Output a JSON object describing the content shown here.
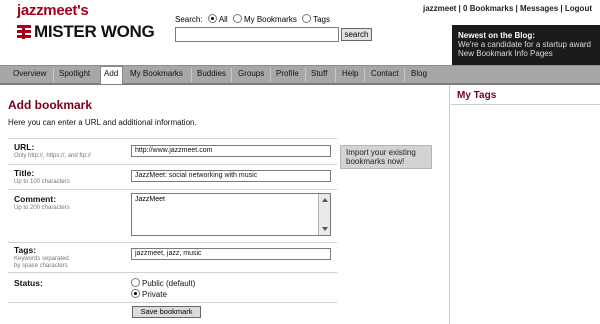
{
  "header": {
    "logo_user": "jazzmeet's",
    "logo_brand": "MISTER WONG",
    "search": {
      "label": "Search:",
      "options": [
        "All",
        "My Bookmarks",
        "Tags"
      ],
      "selected": "All",
      "query": "",
      "button_label": "search"
    },
    "top_links": [
      "jazzmeet",
      "0 Bookmarks",
      "Messages",
      "Logout"
    ],
    "blog": {
      "title": "Newest on the Blog:",
      "links": [
        "We're a candidate for a startup award",
        "New Bookmark Info Pages"
      ]
    }
  },
  "nav": {
    "items": [
      "Overview",
      "Spotlight",
      "Add",
      "My Bookmarks",
      "Buddies",
      "Groups",
      "Profile",
      "Stuff",
      "Help",
      "Contact",
      "Blog"
    ],
    "active": "Add"
  },
  "sidebar": {
    "title": "My Tags"
  },
  "main": {
    "title": "Add bookmark",
    "intro": "Here you can enter a URL and additional information.",
    "url": {
      "label": "URL:",
      "hint": "Only http://, https://, and ftp://",
      "value": "http://www.jazzmeet.com"
    },
    "title_field": {
      "label": "Title:",
      "hint": "Up to 100 characters",
      "value": "JazzMeet: social networking with music"
    },
    "comment": {
      "label": "Comment:",
      "hint": "Up to 200 characters",
      "value": "JazzMeet"
    },
    "tags": {
      "label": "Tags:",
      "hint_line1": "Keywords separated",
      "hint_line2": "by space characters",
      "value": "jazzmeet, jazz, music"
    },
    "status": {
      "label": "Status:",
      "options": [
        "Public (default)",
        "Private"
      ],
      "selected": "Private"
    },
    "import_button": "Import your existing bookmarks now!",
    "save_button": "Save bookmark"
  },
  "colors": {
    "accent": "#7a0018",
    "nav_bg": "#a7a7a7",
    "blog_bg": "#1b1b1b"
  }
}
